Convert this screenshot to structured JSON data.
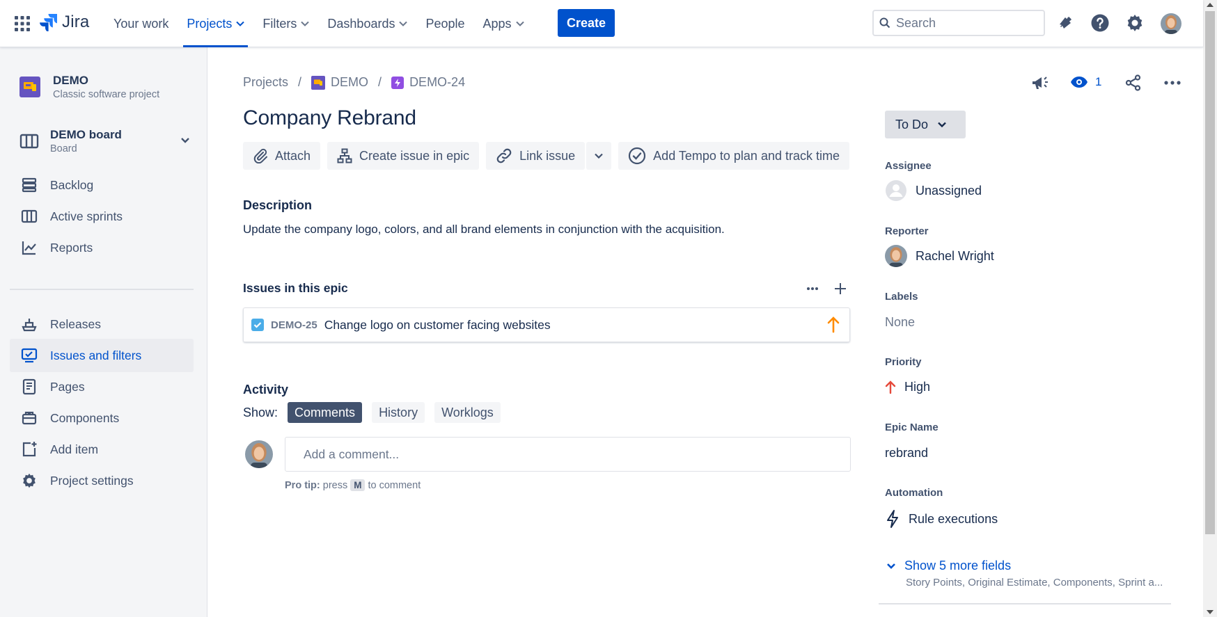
{
  "colors": {
    "accent": "#0052cc",
    "sidebar_bg": "#f4f5f7",
    "text": "#172b4d",
    "muted": "#6b778c",
    "priority_high": "#e5493a",
    "epic_priority": "#ff8b00"
  },
  "topbar": {
    "app_name": "Jira",
    "nav": [
      {
        "label": "Your work",
        "has_dropdown": false,
        "active": false
      },
      {
        "label": "Projects",
        "has_dropdown": true,
        "active": true
      },
      {
        "label": "Filters",
        "has_dropdown": true,
        "active": false
      },
      {
        "label": "Dashboards",
        "has_dropdown": true,
        "active": false
      },
      {
        "label": "People",
        "has_dropdown": false,
        "active": false
      },
      {
        "label": "Apps",
        "has_dropdown": true,
        "active": false
      }
    ],
    "create_label": "Create",
    "search_placeholder": "Search",
    "icons": [
      "app-switcher-icon",
      "notifications-icon",
      "help-icon",
      "settings-icon",
      "profile-avatar"
    ]
  },
  "sidebar": {
    "project": {
      "name": "DEMO",
      "type": "Classic software project"
    },
    "board": {
      "name": "DEMO board",
      "sub": "Board"
    },
    "items": [
      {
        "label": "Backlog",
        "icon": "backlog-icon",
        "active": false
      },
      {
        "label": "Active sprints",
        "icon": "sprints-icon",
        "active": false
      },
      {
        "label": "Reports",
        "icon": "reports-icon",
        "active": false
      },
      {
        "label": "Releases",
        "icon": "releases-icon",
        "active": false
      },
      {
        "label": "Issues and filters",
        "icon": "issues-icon",
        "active": true
      },
      {
        "label": "Pages",
        "icon": "pages-icon",
        "active": false
      },
      {
        "label": "Components",
        "icon": "components-icon",
        "active": false
      },
      {
        "label": "Add item",
        "icon": "add-item-icon",
        "active": false
      },
      {
        "label": "Project settings",
        "icon": "settings-icon",
        "active": false
      }
    ]
  },
  "breadcrumb": {
    "projects": "Projects",
    "project": "DEMO",
    "issue": "DEMO-24"
  },
  "issue": {
    "title": "Company Rebrand",
    "actions": {
      "attach": "Attach",
      "create_in_epic": "Create issue in epic",
      "link": "Link issue",
      "tempo": "Add Tempo to plan and track time"
    },
    "description_label": "Description",
    "description": "Update the company logo, colors, and all brand elements in conjunction with the acquisition.",
    "epic_label": "Issues in this epic",
    "epic_issues": [
      {
        "key": "DEMO-25",
        "summary": "Change logo on customer facing websites",
        "done_checkbox": true,
        "priority": "High"
      }
    ],
    "activity": {
      "label": "Activity",
      "show_label": "Show:",
      "tabs": [
        {
          "label": "Comments",
          "active": true
        },
        {
          "label": "History",
          "active": false
        },
        {
          "label": "Worklogs",
          "active": false
        }
      ],
      "comment_placeholder": "Add a comment...",
      "protip_bold": "Pro tip:",
      "protip_pre": "press",
      "protip_key": "M",
      "protip_post": "to comment"
    }
  },
  "right_panel": {
    "watchers_count": "1",
    "status": "To Do",
    "assignee_label": "Assignee",
    "assignee": "Unassigned",
    "reporter_label": "Reporter",
    "reporter": "Rachel Wright",
    "labels_label": "Labels",
    "labels": "None",
    "priority_label": "Priority",
    "priority": "High",
    "epic_name_label": "Epic Name",
    "epic_name": "rebrand",
    "automation_label": "Automation",
    "automation": "Rule executions",
    "more_fields": "Show 5 more fields",
    "more_fields_sub": "Story Points, Original Estimate, Components, Sprint a..."
  }
}
